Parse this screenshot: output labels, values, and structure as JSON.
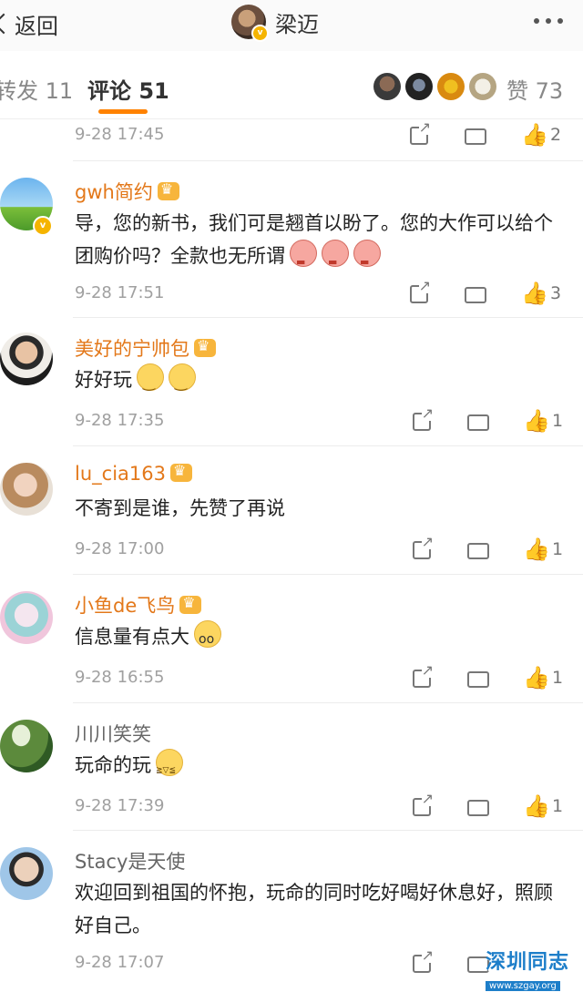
{
  "header": {
    "back_label": "返回",
    "title": "梁迈",
    "verified_badge": "v"
  },
  "tabs": {
    "repost": "转发 11",
    "comments": "评论 51",
    "likes": "赞 73",
    "accent_color": "#ff8200"
  },
  "comments": [
    {
      "time": "9-28 17:45",
      "likes": "2"
    },
    {
      "username": "gwh简约",
      "verified": "v",
      "text": "导，您的新书，我们可是翘首以盼了。您的大作可以给个团购价吗？全款也无所谓",
      "time": "9-28 17:51",
      "likes": "3"
    },
    {
      "username": "美好的宁帅包",
      "text": "好好玩",
      "time": "9-28 17:35",
      "likes": "1"
    },
    {
      "username": "lu_cia163",
      "text": "不寄到是谁，先赞了再说",
      "time": "9-28 17:00",
      "likes": "1"
    },
    {
      "username": "小鱼de飞鸟",
      "text": "信息量有点大",
      "time": "9-28 16:55",
      "likes": "1"
    },
    {
      "username": "川川笑笑",
      "text": "玩命的玩",
      "time": "9-28 17:39",
      "likes": "1"
    },
    {
      "username": "Stacy是天使",
      "text": "欢迎回到祖国的怀抱，玩命的同时吃好喝好休息好，照顾好自己。",
      "time": "9-28 17:07"
    }
  ],
  "watermark": {
    "main": "深圳同志",
    "url": "www.szgay.org"
  }
}
